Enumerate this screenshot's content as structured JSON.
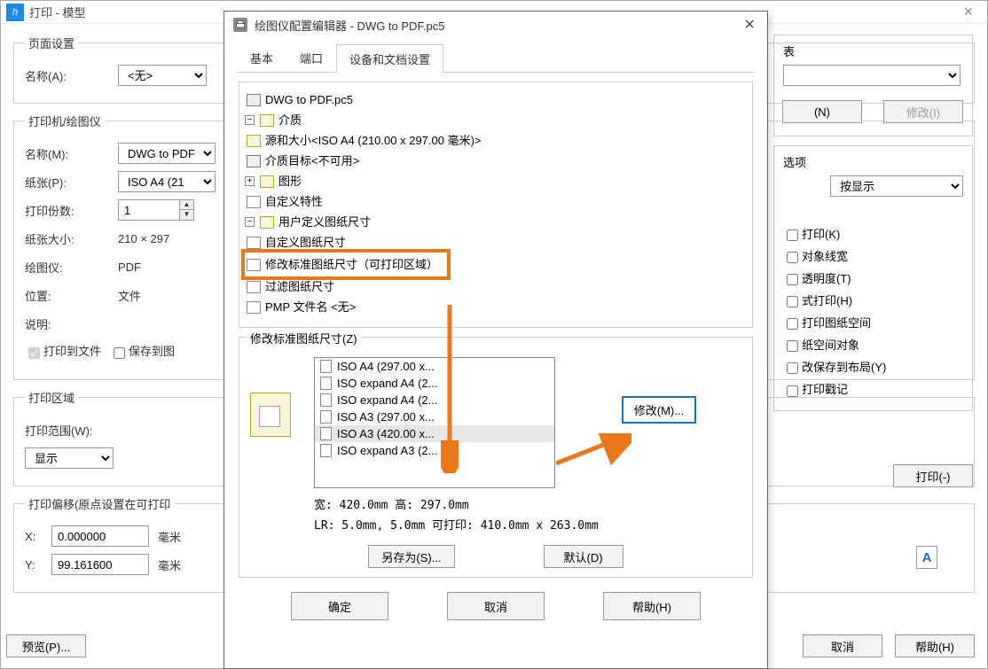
{
  "bgDialog": {
    "title": "打印 - 模型",
    "pageSetup": {
      "legend": "页面设置",
      "nameLabel": "名称(A):",
      "nameValue": "<无>"
    },
    "printer": {
      "legend": "打印机/绘图仪",
      "nameLabel": "名称(M):",
      "nameValue": "DWG to PDF",
      "paperLabel": "纸张(P):",
      "paperValue": "ISO A4 (21",
      "copiesLabel": "打印份数:",
      "copiesValue": "1",
      "paperSizeLabel": "纸张大小:",
      "paperSizeValue": "210 × 297",
      "plotterLabel": "绘图仪:",
      "plotterValue": "PDF",
      "locationLabel": "位置:",
      "locationValue": "文件",
      "descLabel": "说明:",
      "printToFile": "打印到文件",
      "saveToImage": "保存到图"
    },
    "area": {
      "legend": "打印区域",
      "rangeLabel": "打印范围(W):",
      "rangeValue": "显示"
    },
    "offset": {
      "legend": "打印偏移(原点设置在可打印",
      "xLabel": "X:",
      "xValue": "0.000000",
      "xUnit": "毫米",
      "yLabel": "Y:",
      "yValue": "99.161600",
      "yUnit": "毫米"
    },
    "right": {
      "tableLabel": "表",
      "btnN": "(N)",
      "btnModify": "修改(I)",
      "optionsLabel": "选项",
      "shadeValue": "按显示",
      "checks": {
        "c1": "打印(K)",
        "c2": "对象线宽",
        "c3": "透明度(T)",
        "c4": "式打印(H)",
        "c5": "打印图纸空间",
        "c6": "纸空间对象",
        "c7": "改保存到布局(Y)",
        "c8": "打印戳记"
      },
      "applyPrint": "打印(-)"
    },
    "bottom": {
      "preview": "预览(P)...",
      "cancel": "取消",
      "help": "帮助(H)"
    }
  },
  "modal": {
    "title": "绘图仪配置编辑器 - DWG to PDF.pc5",
    "tabs": {
      "basic": "基本",
      "port": "端口",
      "device": "设备和文档设置"
    },
    "tree": {
      "root": "DWG to PDF.pc5",
      "media": "介质",
      "sourceSize": "源和大小<ISO A4 (210.00 x 297.00 毫米)>",
      "mediaTarget": "介质目标<不可用>",
      "graphics": "图形",
      "customProps": "自定义特性",
      "userPaper": "用户定义图纸尺寸",
      "customPaper": "自定义图纸尺寸",
      "modifyStd": "修改标准图纸尺寸（可打印区域）",
      "filterPaper": "过滤图纸尺寸",
      "pmpFile": "PMP 文件名 <无>"
    },
    "modifySection": {
      "label": "修改标准图纸尺寸(Z)",
      "items": [
        "ISO A4 (297.00 x...",
        "ISO expand A4 (2...",
        "ISO expand A4 (2...",
        "ISO A3 (297.00 x...",
        "ISO A3 (420.00 x...",
        "ISO expand A3 (2..."
      ],
      "selectedIndex": 4,
      "modifyBtn": "修改(M)...",
      "widthHeight": "宽: 420.0mm 高: 297.0mm",
      "lrInfo": "LR: 5.0mm, 5.0mm 可打印: 410.0mm x 263.0mm",
      "saveAs": "另存为(S)...",
      "default": "默认(D)"
    },
    "buttons": {
      "ok": "确定",
      "cancel": "取消",
      "help": "帮助(H)"
    }
  }
}
